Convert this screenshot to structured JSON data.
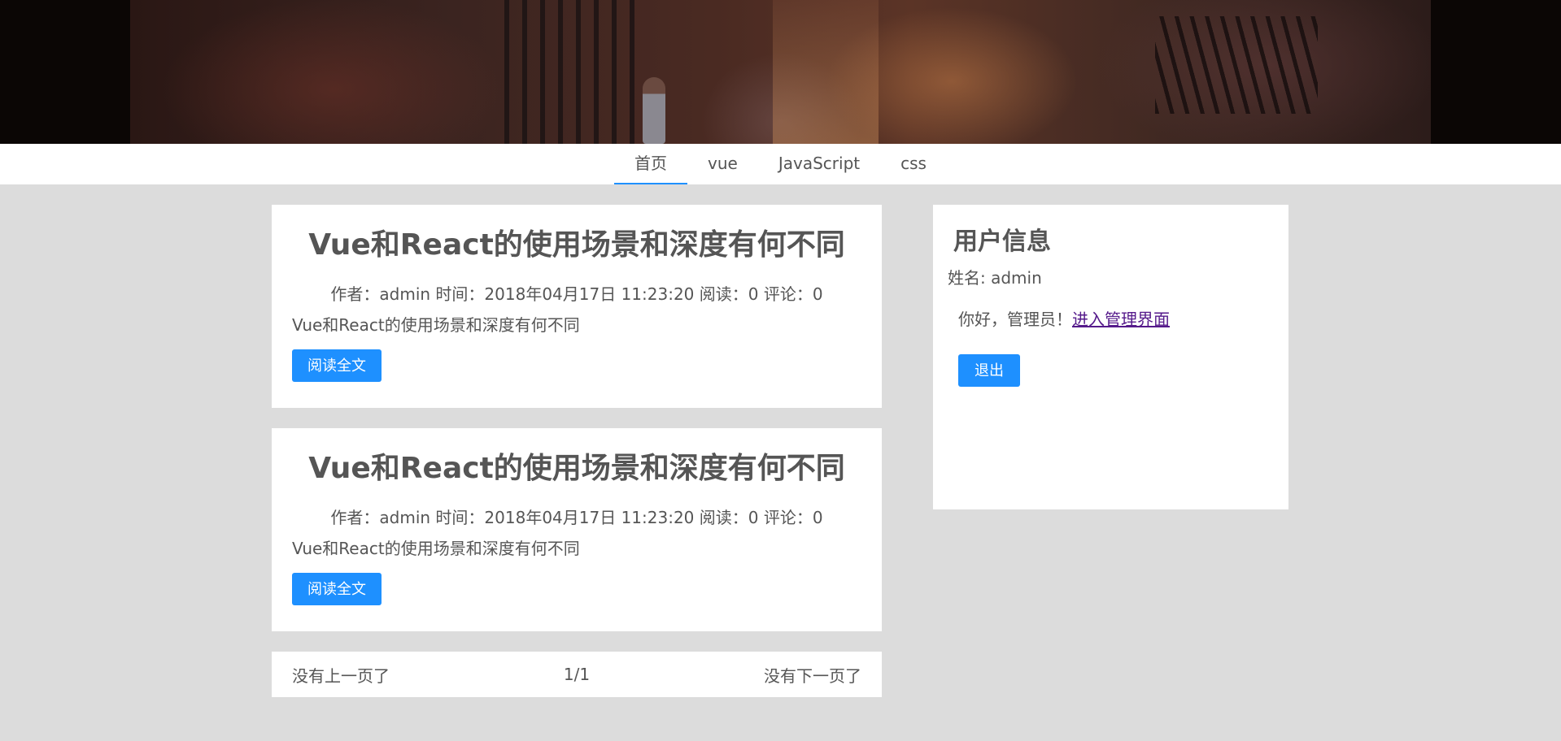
{
  "nav": {
    "items": [
      {
        "label": "首页",
        "active": true
      },
      {
        "label": "vue",
        "active": false
      },
      {
        "label": "JavaScript",
        "active": false
      },
      {
        "label": "css",
        "active": false
      }
    ]
  },
  "posts": [
    {
      "title": "Vue和React的使用场景和深度有何不同",
      "meta": "作者：admin 时间：2018年04月17日 11:23:20 阅读：0 评论：0",
      "summary": "Vue和React的使用场景和深度有何不同",
      "read_more": "阅读全文"
    },
    {
      "title": "Vue和React的使用场景和深度有何不同",
      "meta": "作者：admin 时间：2018年04月17日 11:23:20 阅读：0 评论：0",
      "summary": "Vue和React的使用场景和深度有何不同",
      "read_more": "阅读全文"
    }
  ],
  "pager": {
    "prev": "没有上一页了",
    "page": "1/1",
    "next": "没有下一页了"
  },
  "sidebar": {
    "title": "用户信息",
    "name": "姓名: admin",
    "greeting": "你好，管理员！",
    "admin_link": "进入管理界面",
    "logout": "退出"
  },
  "colors": {
    "accent": "#1e90ff",
    "page_bg": "#dcdcdc",
    "text": "#555555",
    "visited_link": "#551a8b"
  }
}
